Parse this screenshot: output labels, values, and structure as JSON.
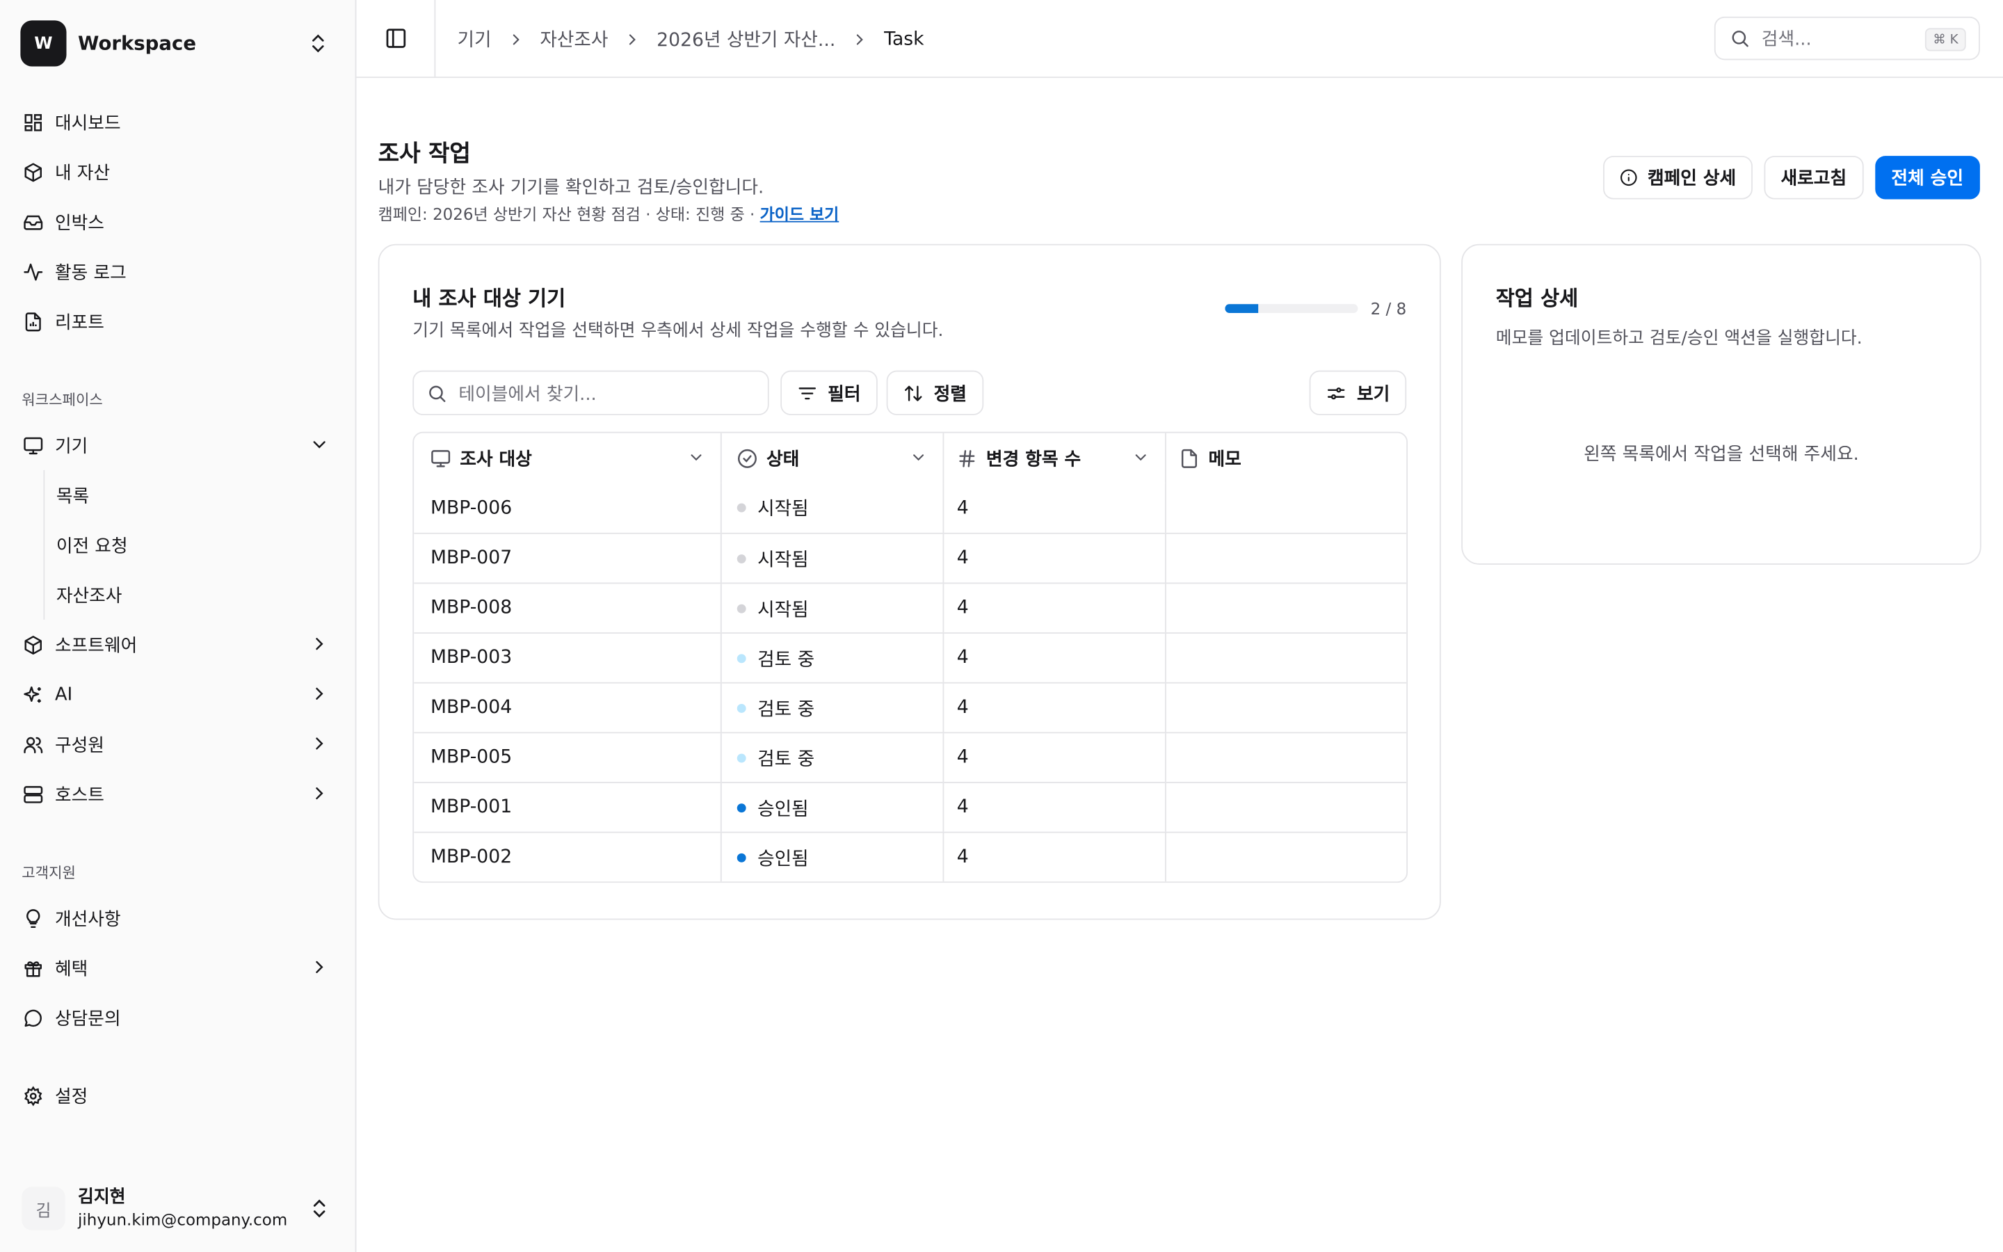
{
  "sidebar": {
    "workspace": {
      "logo": "W",
      "name": "Workspace"
    },
    "nav": [
      {
        "label": "대시보드",
        "icon": "dashboard-icon"
      },
      {
        "label": "내 자산",
        "icon": "box-icon"
      },
      {
        "label": "인박스",
        "icon": "inbox-icon"
      },
      {
        "label": "활동 로그",
        "icon": "activity-icon"
      },
      {
        "label": "리포트",
        "icon": "report-icon"
      }
    ],
    "section_workspace": "워크스페이스",
    "workspace_items": [
      {
        "label": "기기",
        "icon": "monitor-icon",
        "expanded": true
      },
      {
        "label": "소프트웨어",
        "icon": "box-icon"
      },
      {
        "label": "AI",
        "icon": "sparkles-icon"
      },
      {
        "label": "구성원",
        "icon": "users-icon"
      },
      {
        "label": "호스트",
        "icon": "server-icon"
      }
    ],
    "device_sub": [
      "목록",
      "이전 요청",
      "자산조사"
    ],
    "section_support": "고객지원",
    "support_items": [
      {
        "label": "개선사항",
        "icon": "lightbulb-icon"
      },
      {
        "label": "혜택",
        "icon": "gift-icon"
      },
      {
        "label": "상담문의",
        "icon": "chat-icon"
      }
    ],
    "settings": "설정",
    "user": {
      "initial": "김",
      "name": "김지현",
      "email": "jihyun.kim@company.com"
    }
  },
  "header": {
    "breadcrumbs": [
      "기기",
      "자산조사",
      "2026년 상반기 자산...",
      "Task"
    ],
    "search_placeholder": "검색...",
    "search_shortcut": "⌘ K"
  },
  "page": {
    "title": "조사 작업",
    "description": "내가 담당한 조사 기기를 확인하고 검토/승인합니다.",
    "meta": "캠페인: 2026년 상반기 자산 현황 점검 · 상태: 진행 중 · ",
    "guide_link": "가이드 보기",
    "actions": {
      "campaign": "캠페인 상세",
      "refresh": "새로고침",
      "approve_all": "전체 승인"
    }
  },
  "list_card": {
    "title": "내 조사 대상 기기",
    "description": "기기 목록에서 작업을 선택하면 우측에서 상세 작업을 수행할 수 있습니다.",
    "progress": {
      "done": 2,
      "total": 8,
      "text": "2 / 8"
    },
    "search_placeholder": "테이블에서 찾기...",
    "filter": "필터",
    "sort": "정렬",
    "view": "보기",
    "columns": [
      "조사 대상",
      "상태",
      "변경 항목 수",
      "메모"
    ],
    "rows": [
      {
        "target": "MBP-006",
        "status": "시작됨",
        "changes": "4",
        "memo": ""
      },
      {
        "target": "MBP-007",
        "status": "시작됨",
        "changes": "4",
        "memo": ""
      },
      {
        "target": "MBP-008",
        "status": "시작됨",
        "changes": "4",
        "memo": ""
      },
      {
        "target": "MBP-003",
        "status": "검토 중",
        "changes": "4",
        "memo": ""
      },
      {
        "target": "MBP-004",
        "status": "검토 중",
        "changes": "4",
        "memo": ""
      },
      {
        "target": "MBP-005",
        "status": "검토 중",
        "changes": "4",
        "memo": ""
      },
      {
        "target": "MBP-001",
        "status": "승인됨",
        "changes": "4",
        "memo": ""
      },
      {
        "target": "MBP-002",
        "status": "승인됨",
        "changes": "4",
        "memo": ""
      }
    ],
    "status_colors": {
      "시작됨": "#d4d4d8",
      "검토 중": "#bae6fd",
      "승인됨": "#0a76d6"
    }
  },
  "detail_card": {
    "title": "작업 상세",
    "description": "메모를 업데이트하고 검토/승인 액션을 실행합니다.",
    "empty": "왼쪽 목록에서 작업을 선택해 주세요."
  },
  "colors": {
    "primary": "#0070f0",
    "border": "#e4e4e7",
    "sidebar_bg": "#fafafa"
  }
}
